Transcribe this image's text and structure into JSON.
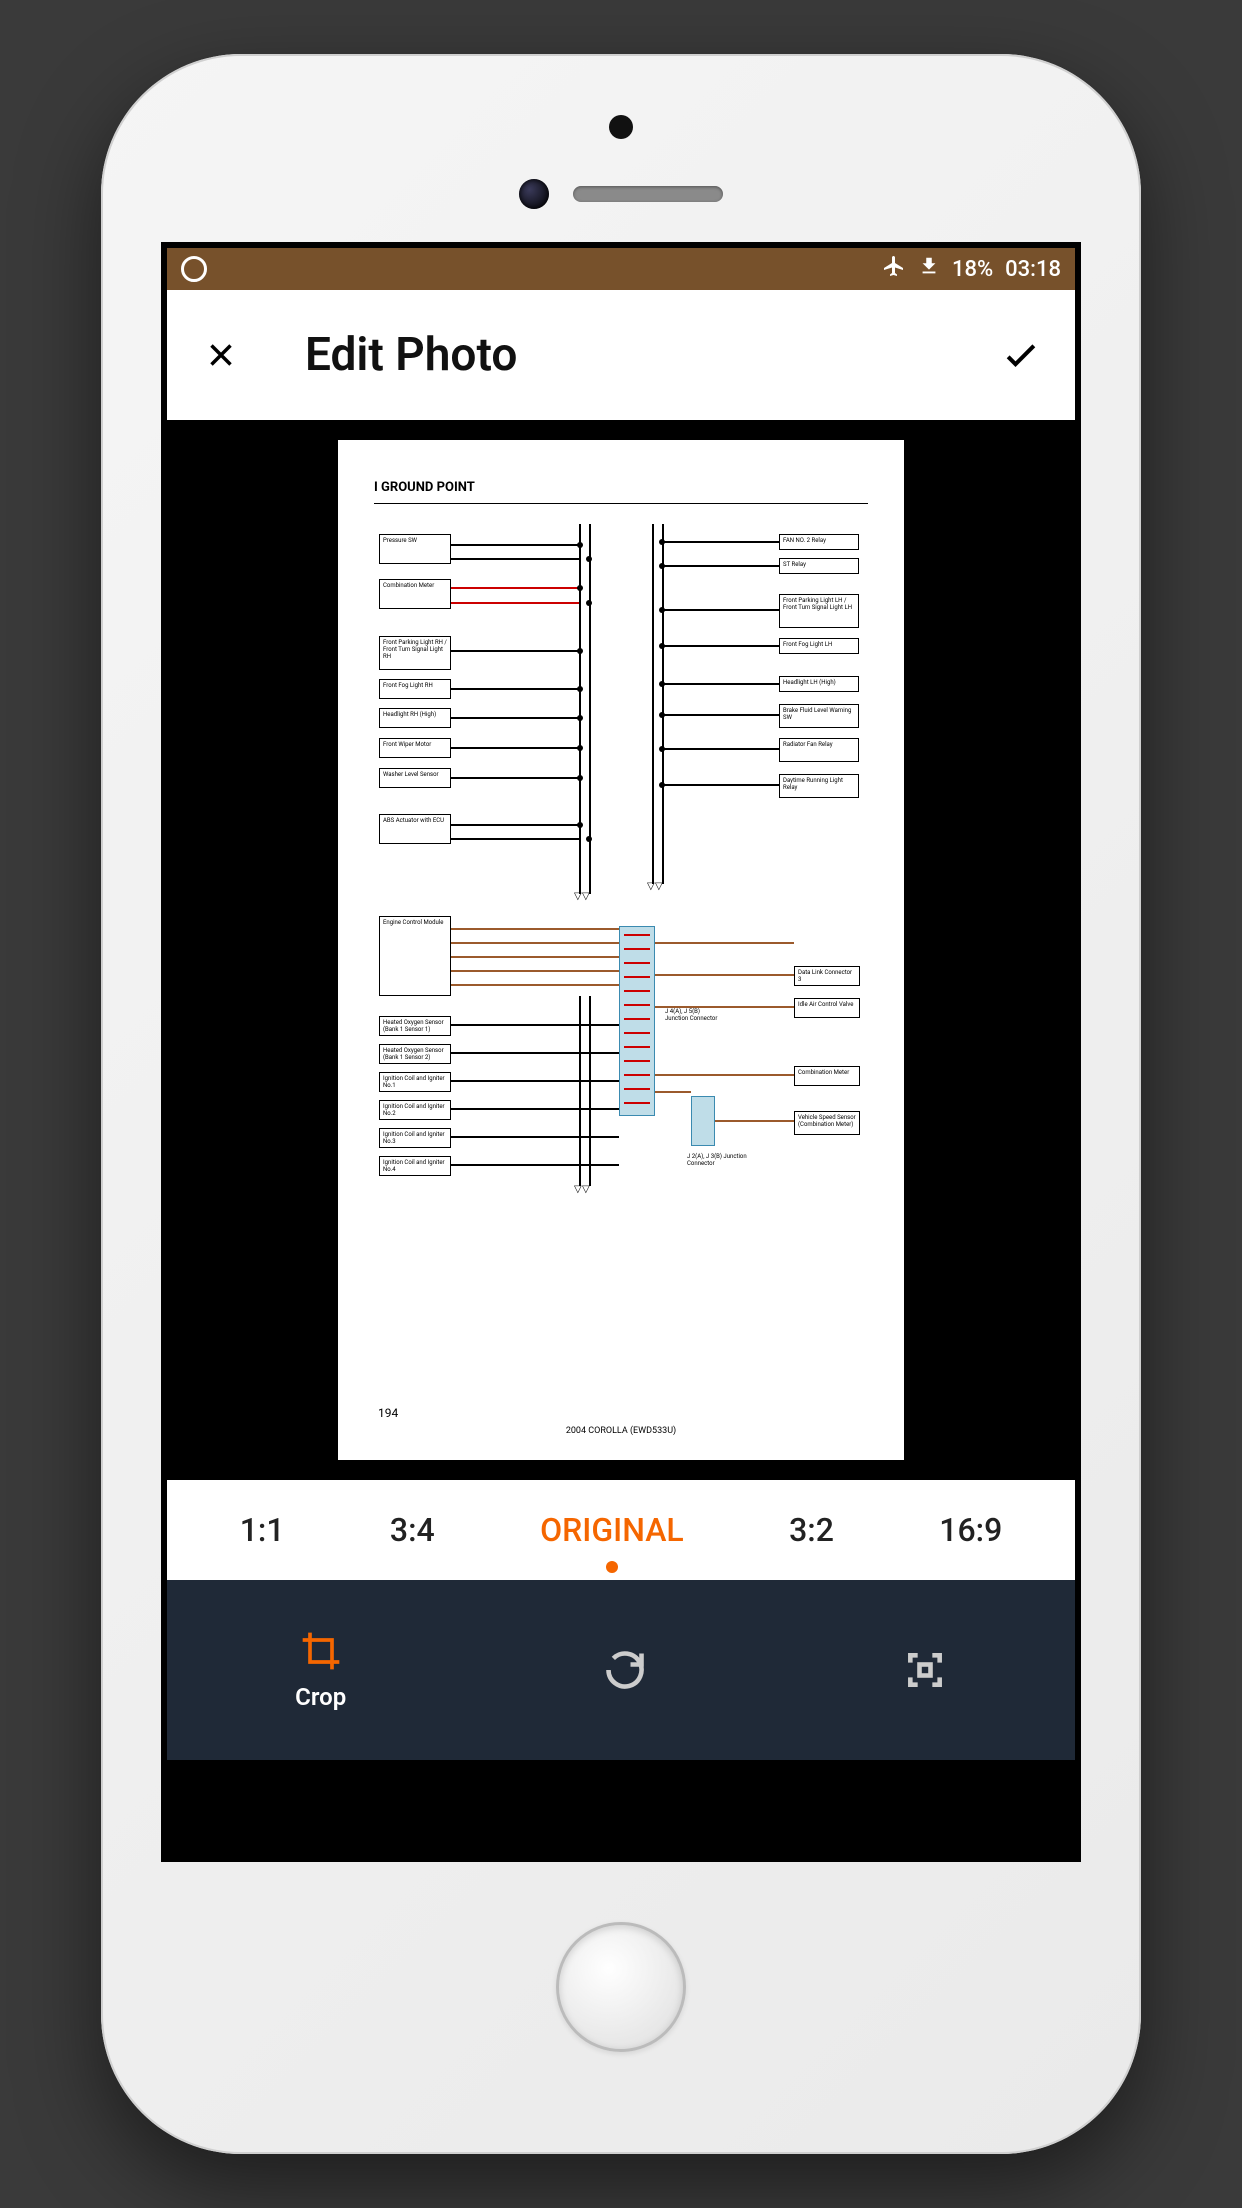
{
  "status_bar": {
    "battery": "18%",
    "time": "03:18"
  },
  "header": {
    "title": "Edit Photo"
  },
  "document": {
    "title": "I  GROUND POINT",
    "page_number": "194",
    "model": "2004 COROLLA (EWD533U)"
  },
  "ratios": [
    {
      "label": "1:1",
      "active": false
    },
    {
      "label": "3:4",
      "active": false
    },
    {
      "label": "ORIGINAL",
      "active": true
    },
    {
      "label": "3:2",
      "active": false
    },
    {
      "label": "16:9",
      "active": false
    }
  ],
  "tools": [
    {
      "label": "Crop",
      "active": true
    },
    {
      "label": "",
      "icon": "rotate",
      "active": false
    },
    {
      "label": "",
      "icon": "frame",
      "active": false
    }
  ]
}
